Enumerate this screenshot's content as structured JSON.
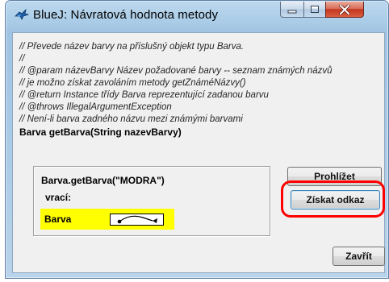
{
  "window": {
    "title": "BlueJ:  Návratová hodnota metody",
    "icon": "bluej-bird-icon"
  },
  "titlebar_buttons": {
    "minimize": "minimize-icon",
    "maximize": "maximize-icon",
    "close": "close-icon"
  },
  "doc": {
    "lines": [
      "// Převede název barvy na příslušný objekt typu Barva.",
      "//",
      "// @param názevBarvy  Název požadované barvy -- seznam známých názvů",
      "// je možno získat zavoláním metody getZnáméNázvy()",
      "// @return Instance třídy Barva reprezentující zadanou barvu",
      "// @throws IllegalArgumentException",
      "// Není-li barva zadného názvu mezi známými barvami"
    ],
    "signature": "Barva getBarva(String nazevBarvy)"
  },
  "result": {
    "call": "Barva.getBarva(\"MODRA\")",
    "returns_label": "vrací:",
    "return_type": "Barva"
  },
  "buttons": {
    "inspect": "Prohlížet",
    "get_reference": "Získat odkaz",
    "close": "Zavřít"
  },
  "colors": {
    "return_highlight": "#ffff00",
    "annotation": "#ff0000"
  }
}
